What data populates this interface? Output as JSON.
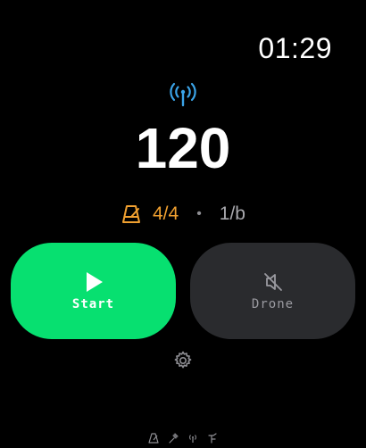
{
  "status_bar": {
    "clock": "01:29"
  },
  "main": {
    "connection_icon": "antenna-broadcast-icon",
    "tempo": "120",
    "time_signature": "4/4",
    "separator": "•",
    "subdivision": "1/b",
    "metronome_icon": "metronome-icon"
  },
  "buttons": {
    "start_label": "Start",
    "start_icon": "play-icon",
    "drone_label": "Drone",
    "drone_icon": "speaker-muted-icon"
  },
  "settings": {
    "icon": "gear-icon"
  },
  "page_indicator": {
    "icons": [
      "metronome-icon",
      "tuning-fork-icon",
      "antenna-icon",
      "practice-icon"
    ]
  },
  "colors": {
    "background": "#000000",
    "accent_green": "#07e070",
    "accent_orange": "#f0a030",
    "accent_blue": "#3ba4e8",
    "button_dark": "#2a2b2e",
    "text_muted": "#8e8e93"
  }
}
